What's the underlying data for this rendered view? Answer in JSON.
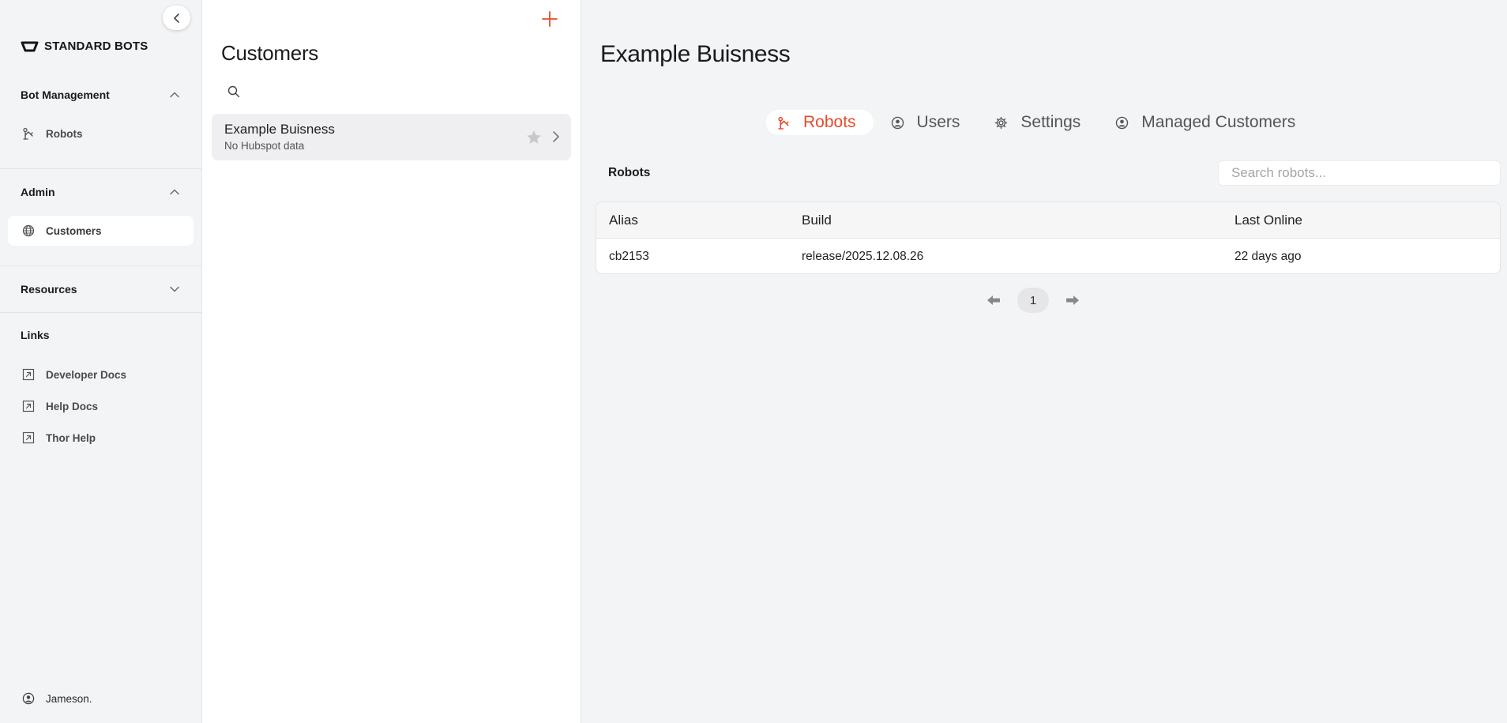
{
  "brand": {
    "name": "STANDARD BOTS"
  },
  "sidebar": {
    "sections": [
      {
        "title": "Bot Management",
        "expanded": true,
        "items": [
          {
            "label": "Robots",
            "icon": "robot-arm-icon"
          }
        ]
      },
      {
        "title": "Admin",
        "expanded": true,
        "items": [
          {
            "label": "Customers",
            "icon": "globe-icon",
            "active": true
          }
        ]
      },
      {
        "title": "Resources",
        "expanded": false,
        "items": []
      }
    ],
    "links_title": "Links",
    "links": [
      {
        "label": "Developer Docs",
        "icon": "external-link-icon"
      },
      {
        "label": "Help Docs",
        "icon": "external-link-icon"
      },
      {
        "label": "Thor Help",
        "icon": "external-link-icon"
      }
    ],
    "user": {
      "name": "Jameson.",
      "icon": "user-circle-icon"
    }
  },
  "customers_panel": {
    "title": "Customers",
    "search": {
      "placeholder": "",
      "value": ""
    },
    "items": [
      {
        "name": "Example Buisness",
        "subtitle": "No Hubspot data",
        "starred": false
      }
    ]
  },
  "detail": {
    "title": "Example Buisness",
    "tabs": [
      {
        "label": "Robots",
        "icon": "robot-arm-icon",
        "active": true
      },
      {
        "label": "Users",
        "icon": "user-circle-icon",
        "active": false
      },
      {
        "label": "Settings",
        "icon": "gear-icon",
        "active": false
      },
      {
        "label": "Managed Customers",
        "icon": "user-circle-icon",
        "active": false
      }
    ],
    "section_label": "Robots",
    "search": {
      "placeholder": "Search robots...",
      "value": ""
    },
    "table": {
      "columns": [
        "Alias",
        "Build",
        "Last Online"
      ],
      "rows": [
        [
          "cb2153",
          "release/2025.12.08.26",
          "22 days ago"
        ]
      ]
    },
    "pagination": {
      "current_page": "1"
    }
  },
  "colors": {
    "accent": "#e8492a",
    "sidebar_bg": "#f3f4f6",
    "panel_bg": "#ffffff"
  }
}
